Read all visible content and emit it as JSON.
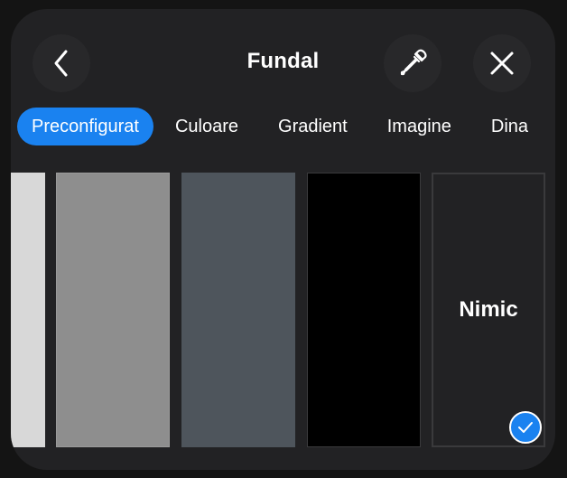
{
  "header": {
    "title": "Fundal",
    "back_icon": "chevron-left-icon",
    "eyedropper_icon": "eyedropper-icon",
    "close_icon": "close-icon"
  },
  "tabs": [
    {
      "label": "Preconfigurat",
      "active": true
    },
    {
      "label": "Culoare",
      "active": false
    },
    {
      "label": "Gradient",
      "active": false
    },
    {
      "label": "Imagine",
      "active": false
    },
    {
      "label": "Dina",
      "active": false
    }
  ],
  "swatches": [
    {
      "color": "#d8d8d8"
    },
    {
      "color": "#8e8e8e"
    },
    {
      "color": "#4e555c"
    },
    {
      "color": "#000000"
    },
    {
      "label": "Nimic",
      "selected": true
    }
  ],
  "colors": {
    "accent": "#1a82f0",
    "panel": "#222224",
    "button": "#28282a"
  }
}
